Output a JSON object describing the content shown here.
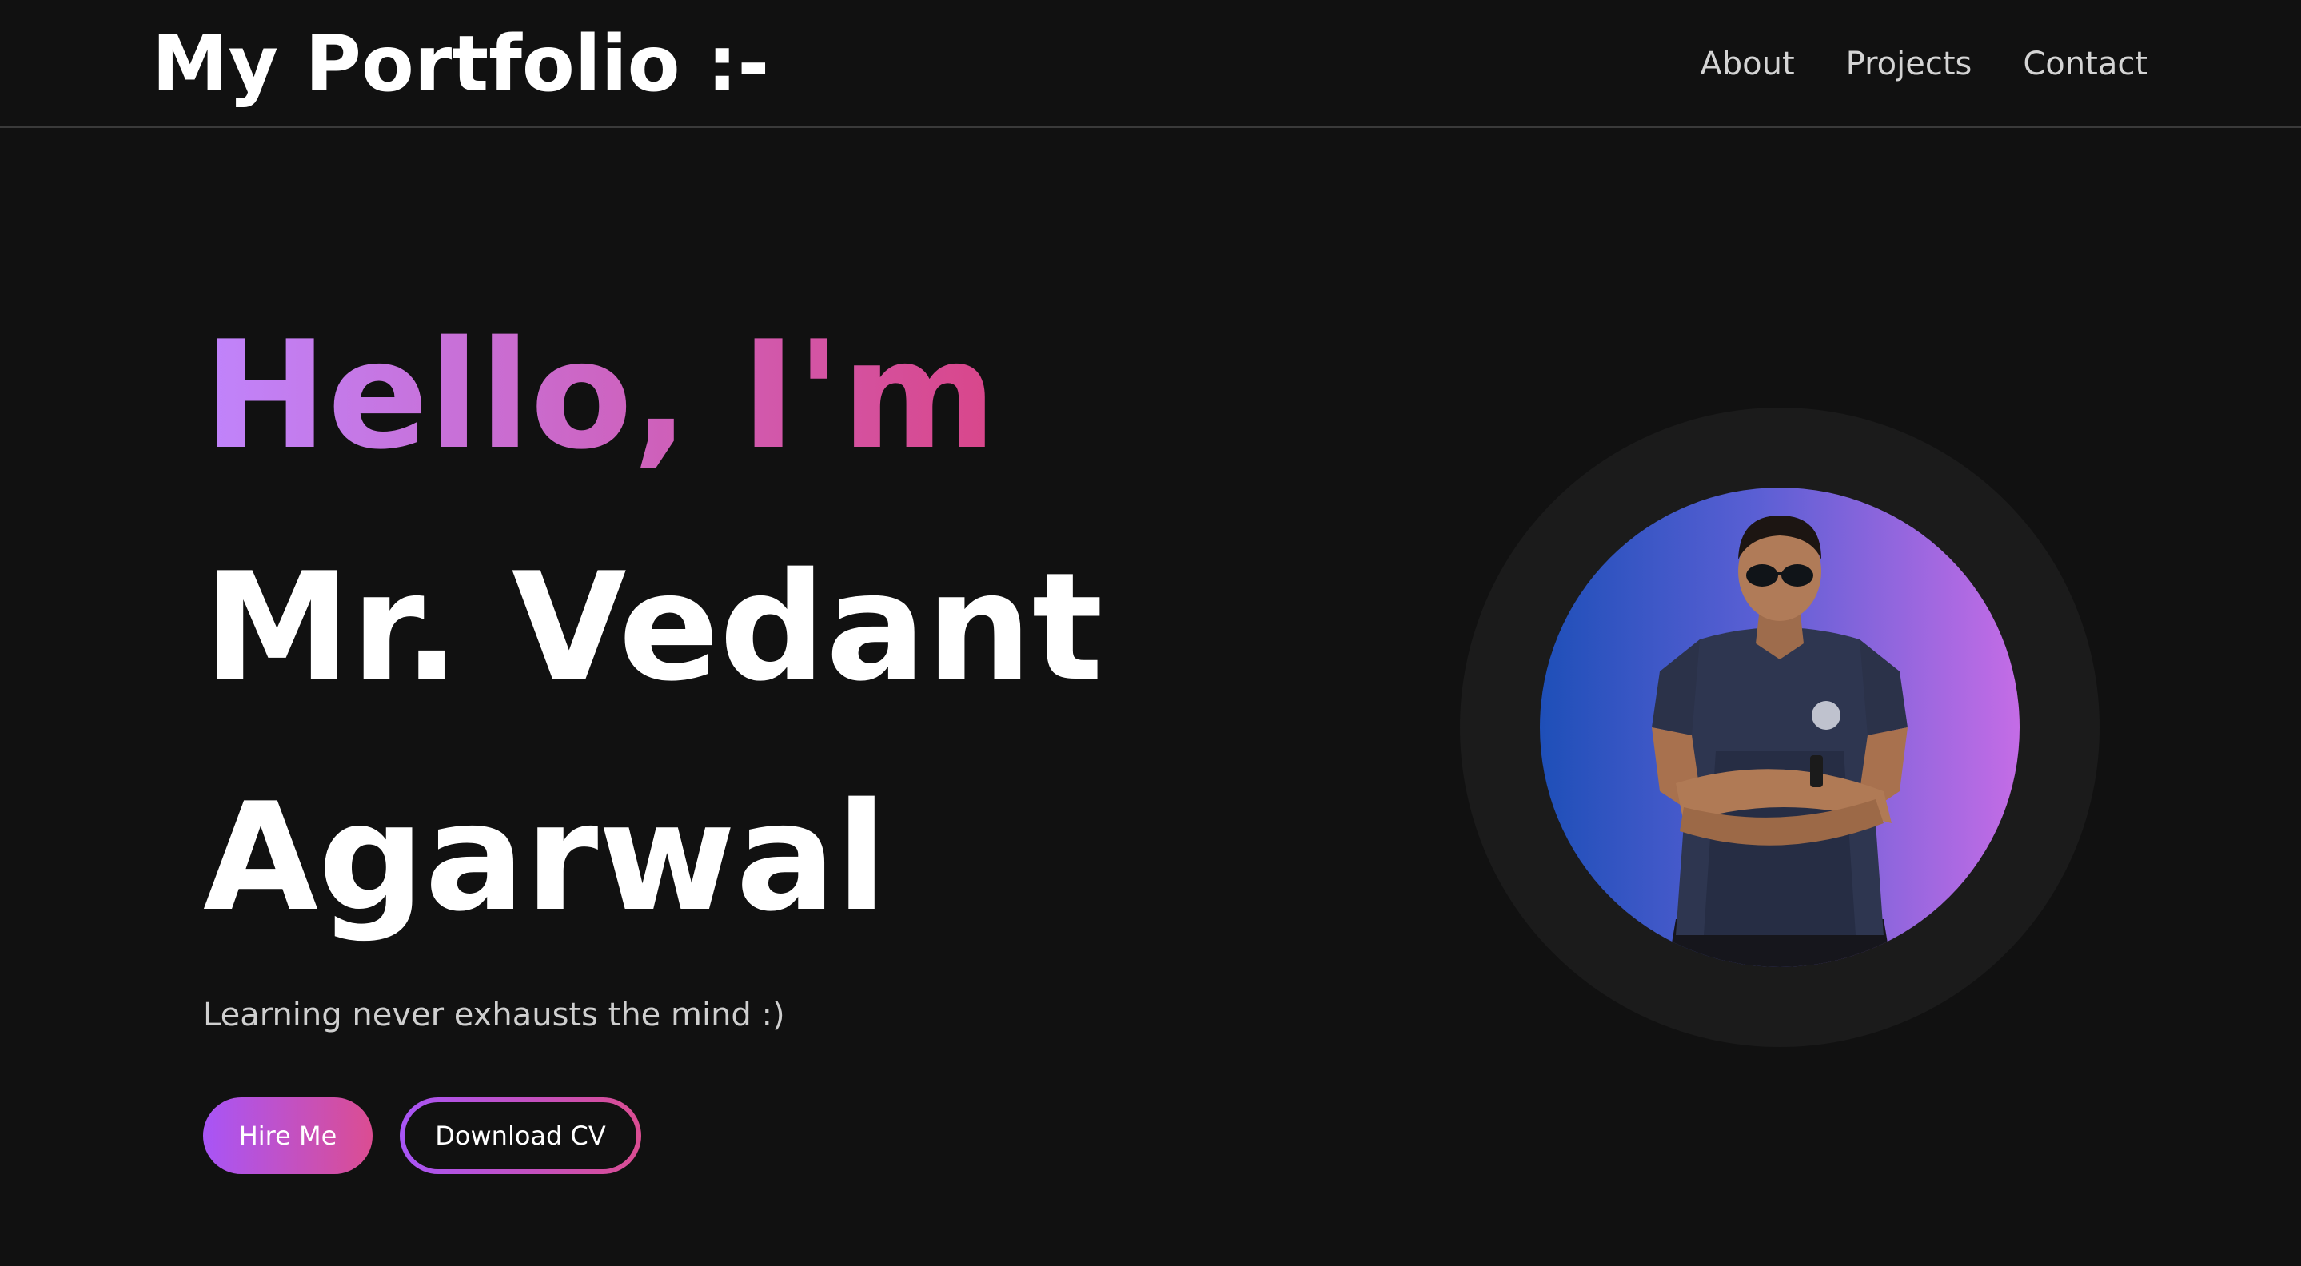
{
  "header": {
    "brand": "My Portfolio :-",
    "nav": [
      {
        "label": "About"
      },
      {
        "label": "Projects"
      },
      {
        "label": "Contact"
      }
    ]
  },
  "hero": {
    "greeting": "Hello, I'm",
    "name_line1": "Mr. Vedant",
    "name_line2": "Agarwal",
    "tagline": "Learning never exhausts the mind :)",
    "hire_label": "Hire Me",
    "cv_label": "Download CV"
  },
  "colors": {
    "background": "#111111",
    "accent_start": "#a855f7",
    "accent_end": "#db4d92",
    "avatar_bg_left": "#1e4fb8",
    "avatar_bg_right": "#c46ce6"
  }
}
